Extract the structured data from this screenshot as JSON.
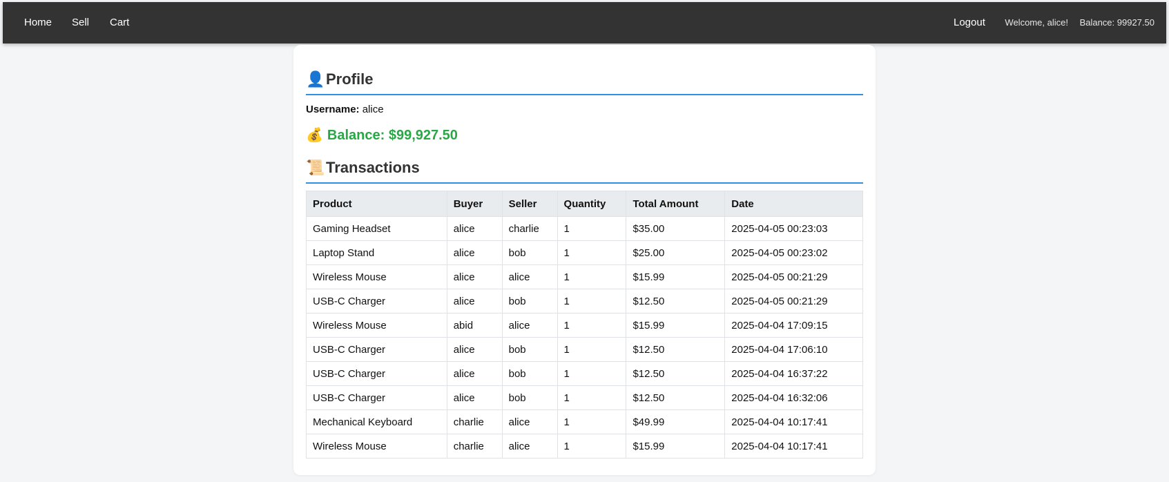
{
  "nav": {
    "home": "Home",
    "sell": "Sell",
    "cart": "Cart",
    "logout": "Logout",
    "welcome": "Welcome, alice!",
    "balance": "Balance: 99927.50"
  },
  "profile": {
    "icon": "user-icon",
    "heading_emoji": "👤",
    "heading": "Profile",
    "username_label": "Username:",
    "username": "alice",
    "balance_emoji": "💰",
    "balance_text": "Balance: $99,927.50",
    "balance_color": "#28a745"
  },
  "transactions": {
    "heading_emoji": "📜",
    "heading": "Transactions",
    "columns": [
      "Product",
      "Buyer",
      "Seller",
      "Quantity",
      "Total Amount",
      "Date"
    ],
    "rows": [
      [
        "Gaming Headset",
        "alice",
        "charlie",
        "1",
        "$35.00",
        "2025-04-05 00:23:03"
      ],
      [
        "Laptop Stand",
        "alice",
        "bob",
        "1",
        "$25.00",
        "2025-04-05 00:23:02"
      ],
      [
        "Wireless Mouse",
        "alice",
        "alice",
        "1",
        "$15.99",
        "2025-04-05 00:21:29"
      ],
      [
        "USB-C Charger",
        "alice",
        "bob",
        "1",
        "$12.50",
        "2025-04-05 00:21:29"
      ],
      [
        "Wireless Mouse",
        "abid",
        "alice",
        "1",
        "$15.99",
        "2025-04-04 17:09:15"
      ],
      [
        "USB-C Charger",
        "alice",
        "bob",
        "1",
        "$12.50",
        "2025-04-04 17:06:10"
      ],
      [
        "USB-C Charger",
        "alice",
        "bob",
        "1",
        "$12.50",
        "2025-04-04 16:37:22"
      ],
      [
        "USB-C Charger",
        "alice",
        "bob",
        "1",
        "$12.50",
        "2025-04-04 16:32:06"
      ],
      [
        "Mechanical Keyboard",
        "charlie",
        "alice",
        "1",
        "$49.99",
        "2025-04-04 10:17:41"
      ],
      [
        "Wireless Mouse",
        "charlie",
        "alice",
        "1",
        "$15.99",
        "2025-04-04 10:17:41"
      ]
    ]
  },
  "colors": {
    "navbar": "#333333",
    "accent": "#2f8fe3",
    "balance": "#28a745"
  }
}
